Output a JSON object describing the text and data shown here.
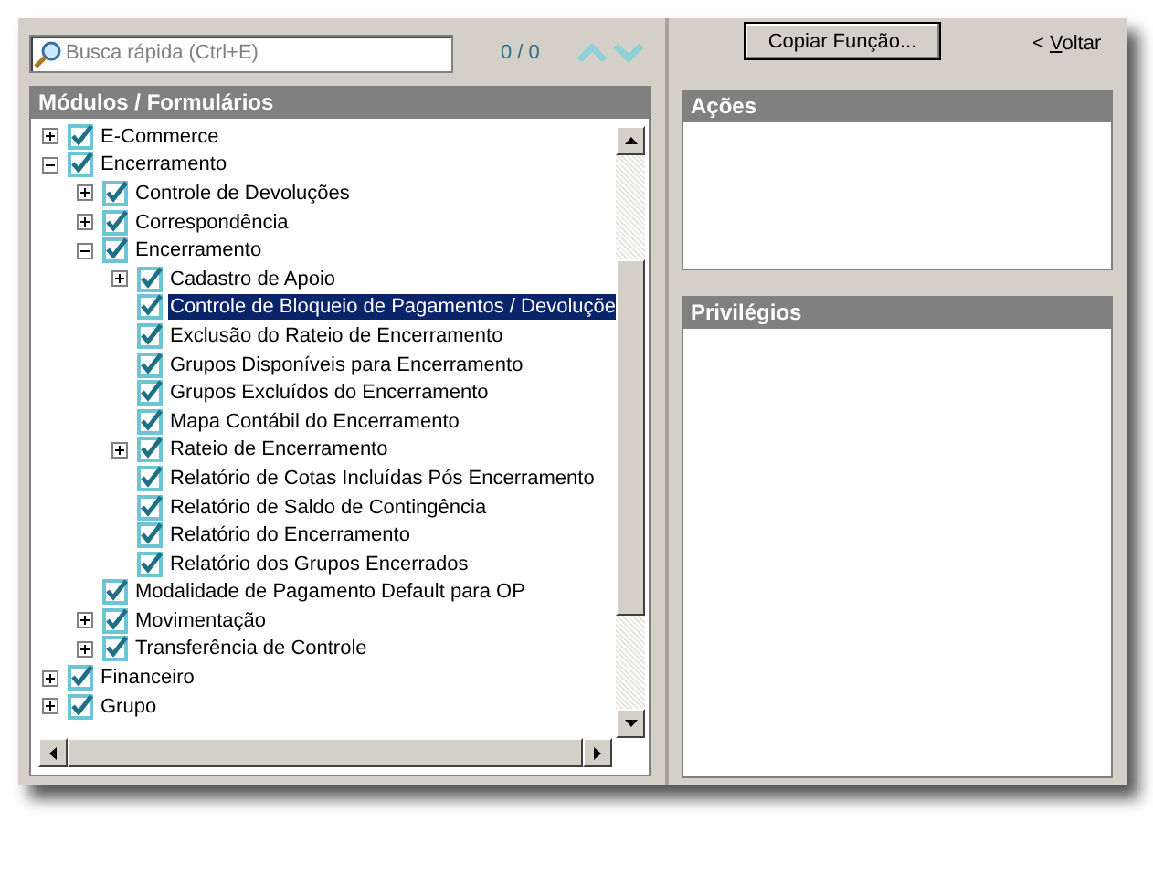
{
  "search": {
    "placeholder": "Busca rápida (Ctrl+E)"
  },
  "match_count": "0 / 0",
  "copy_button": "Copiar Função...",
  "back_link": {
    "arrow": "<",
    "label": "Voltar"
  },
  "modules": {
    "title": "Módulos / Formulários",
    "tree": [
      {
        "label": "E-Commerce",
        "checked": true,
        "expanded": false,
        "selected": false
      },
      {
        "label": "Encerramento",
        "checked": true,
        "expanded": true,
        "selected": false,
        "children": [
          {
            "label": "Controle de Devoluções",
            "checked": true,
            "expanded": false,
            "selected": false
          },
          {
            "label": "Correspondência",
            "checked": true,
            "expanded": false,
            "selected": false
          },
          {
            "label": "Encerramento",
            "checked": true,
            "expanded": true,
            "selected": false,
            "children": [
              {
                "label": "Cadastro de Apoio",
                "checked": true,
                "expanded": false,
                "selected": false
              },
              {
                "label": "Controle de Bloqueio de Pagamentos / Devoluçõe",
                "checked": true,
                "selected": true
              },
              {
                "label": "Exclusão do Rateio de Encerramento",
                "checked": true,
                "selected": false
              },
              {
                "label": "Grupos Disponíveis para Encerramento",
                "checked": true,
                "selected": false
              },
              {
                "label": "Grupos Excluídos do Encerramento",
                "checked": true,
                "selected": false
              },
              {
                "label": "Mapa Contábil do Encerramento",
                "checked": true,
                "selected": false
              },
              {
                "label": "Rateio de Encerramento",
                "checked": true,
                "expanded": false,
                "selected": false
              },
              {
                "label": "Relatório de Cotas Incluídas Pós Encerramento",
                "checked": true,
                "selected": false
              },
              {
                "label": "Relatório de Saldo de Contingência",
                "checked": true,
                "selected": false
              },
              {
                "label": "Relatório do Encerramento",
                "checked": true,
                "selected": false
              },
              {
                "label": "Relatório dos Grupos Encerrados",
                "checked": true,
                "selected": false
              }
            ]
          },
          {
            "label": "Modalidade de Pagamento Default para OP",
            "checked": true,
            "selected": false
          },
          {
            "label": "Movimentação",
            "checked": true,
            "expanded": false,
            "selected": false
          },
          {
            "label": "Transferência de Controle",
            "checked": true,
            "expanded": false,
            "selected": false
          }
        ]
      },
      {
        "label": "Financeiro",
        "checked": true,
        "expanded": false,
        "selected": false
      },
      {
        "label": "Grupo",
        "checked": true,
        "expanded": false,
        "selected": false
      }
    ]
  },
  "actions": {
    "title": "Ações"
  },
  "privileges": {
    "title": "Privilégios"
  }
}
